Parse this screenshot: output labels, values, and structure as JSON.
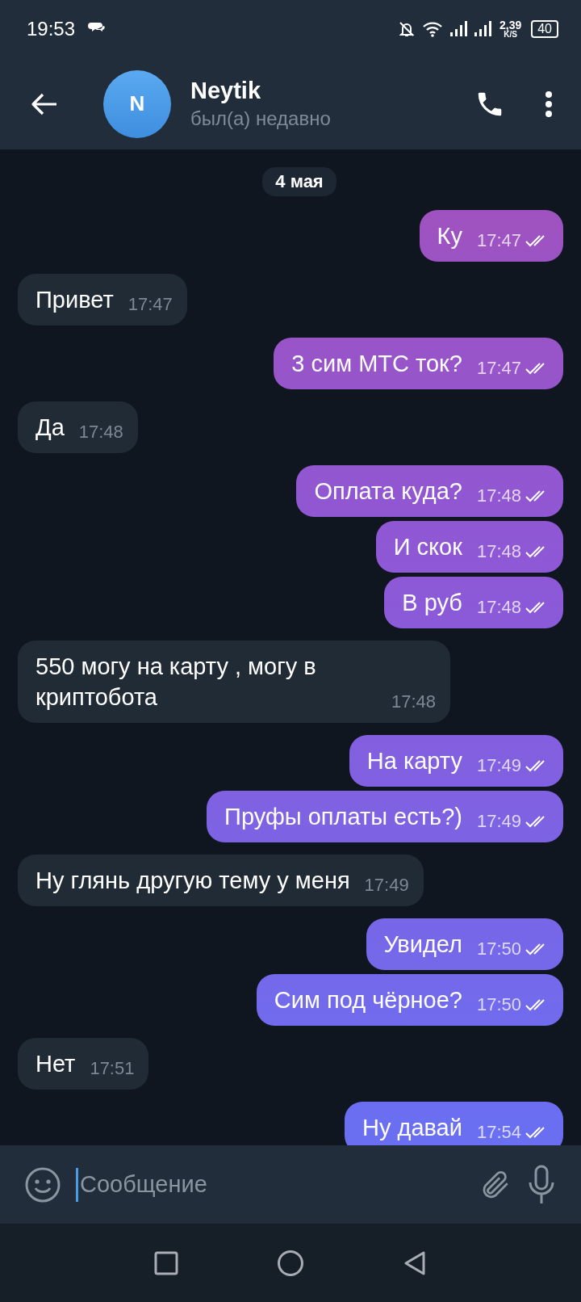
{
  "status_bar": {
    "time": "19:53",
    "speed_value": "2,39",
    "speed_unit": "K/S",
    "battery": "40"
  },
  "header": {
    "avatar_letter": "N",
    "name": "Neytik",
    "last_seen": "был(а) недавно"
  },
  "date": "4 мая",
  "messages": [
    {
      "kind": "out",
      "text": "Ку",
      "time": "17:47",
      "read": true
    },
    {
      "kind": "in",
      "text": "Привет",
      "time": "17:47"
    },
    {
      "kind": "out",
      "text": "3 сим МТС ток?",
      "time": "17:47",
      "read": true
    },
    {
      "kind": "in",
      "text": "Да",
      "time": "17:48"
    },
    {
      "kind": "out",
      "text": "Оплата куда?",
      "time": "17:48",
      "read": true
    },
    {
      "kind": "out",
      "text": "И скок",
      "time": "17:48",
      "read": true
    },
    {
      "kind": "out",
      "text": "В руб",
      "time": "17:48",
      "read": true
    },
    {
      "kind": "in",
      "text": "550 могу на карту , могу в криптобота",
      "time": "17:48"
    },
    {
      "kind": "out",
      "text": "На карту",
      "time": "17:49",
      "read": true
    },
    {
      "kind": "out",
      "text": "Пруфы оплаты есть?)",
      "time": "17:49",
      "read": true
    },
    {
      "kind": "in",
      "text": "Ну глянь другую тему у меня",
      "time": "17:49"
    },
    {
      "kind": "out",
      "text": "Увидел",
      "time": "17:50",
      "read": true
    },
    {
      "kind": "out",
      "text": "Сим под чёрное?",
      "time": "17:50",
      "read": true
    },
    {
      "kind": "in",
      "text": "Нет",
      "time": "17:51"
    },
    {
      "kind": "out",
      "text": "Ну давай",
      "time": "17:54",
      "read": true
    }
  ],
  "composer": {
    "placeholder": "Сообщение"
  }
}
